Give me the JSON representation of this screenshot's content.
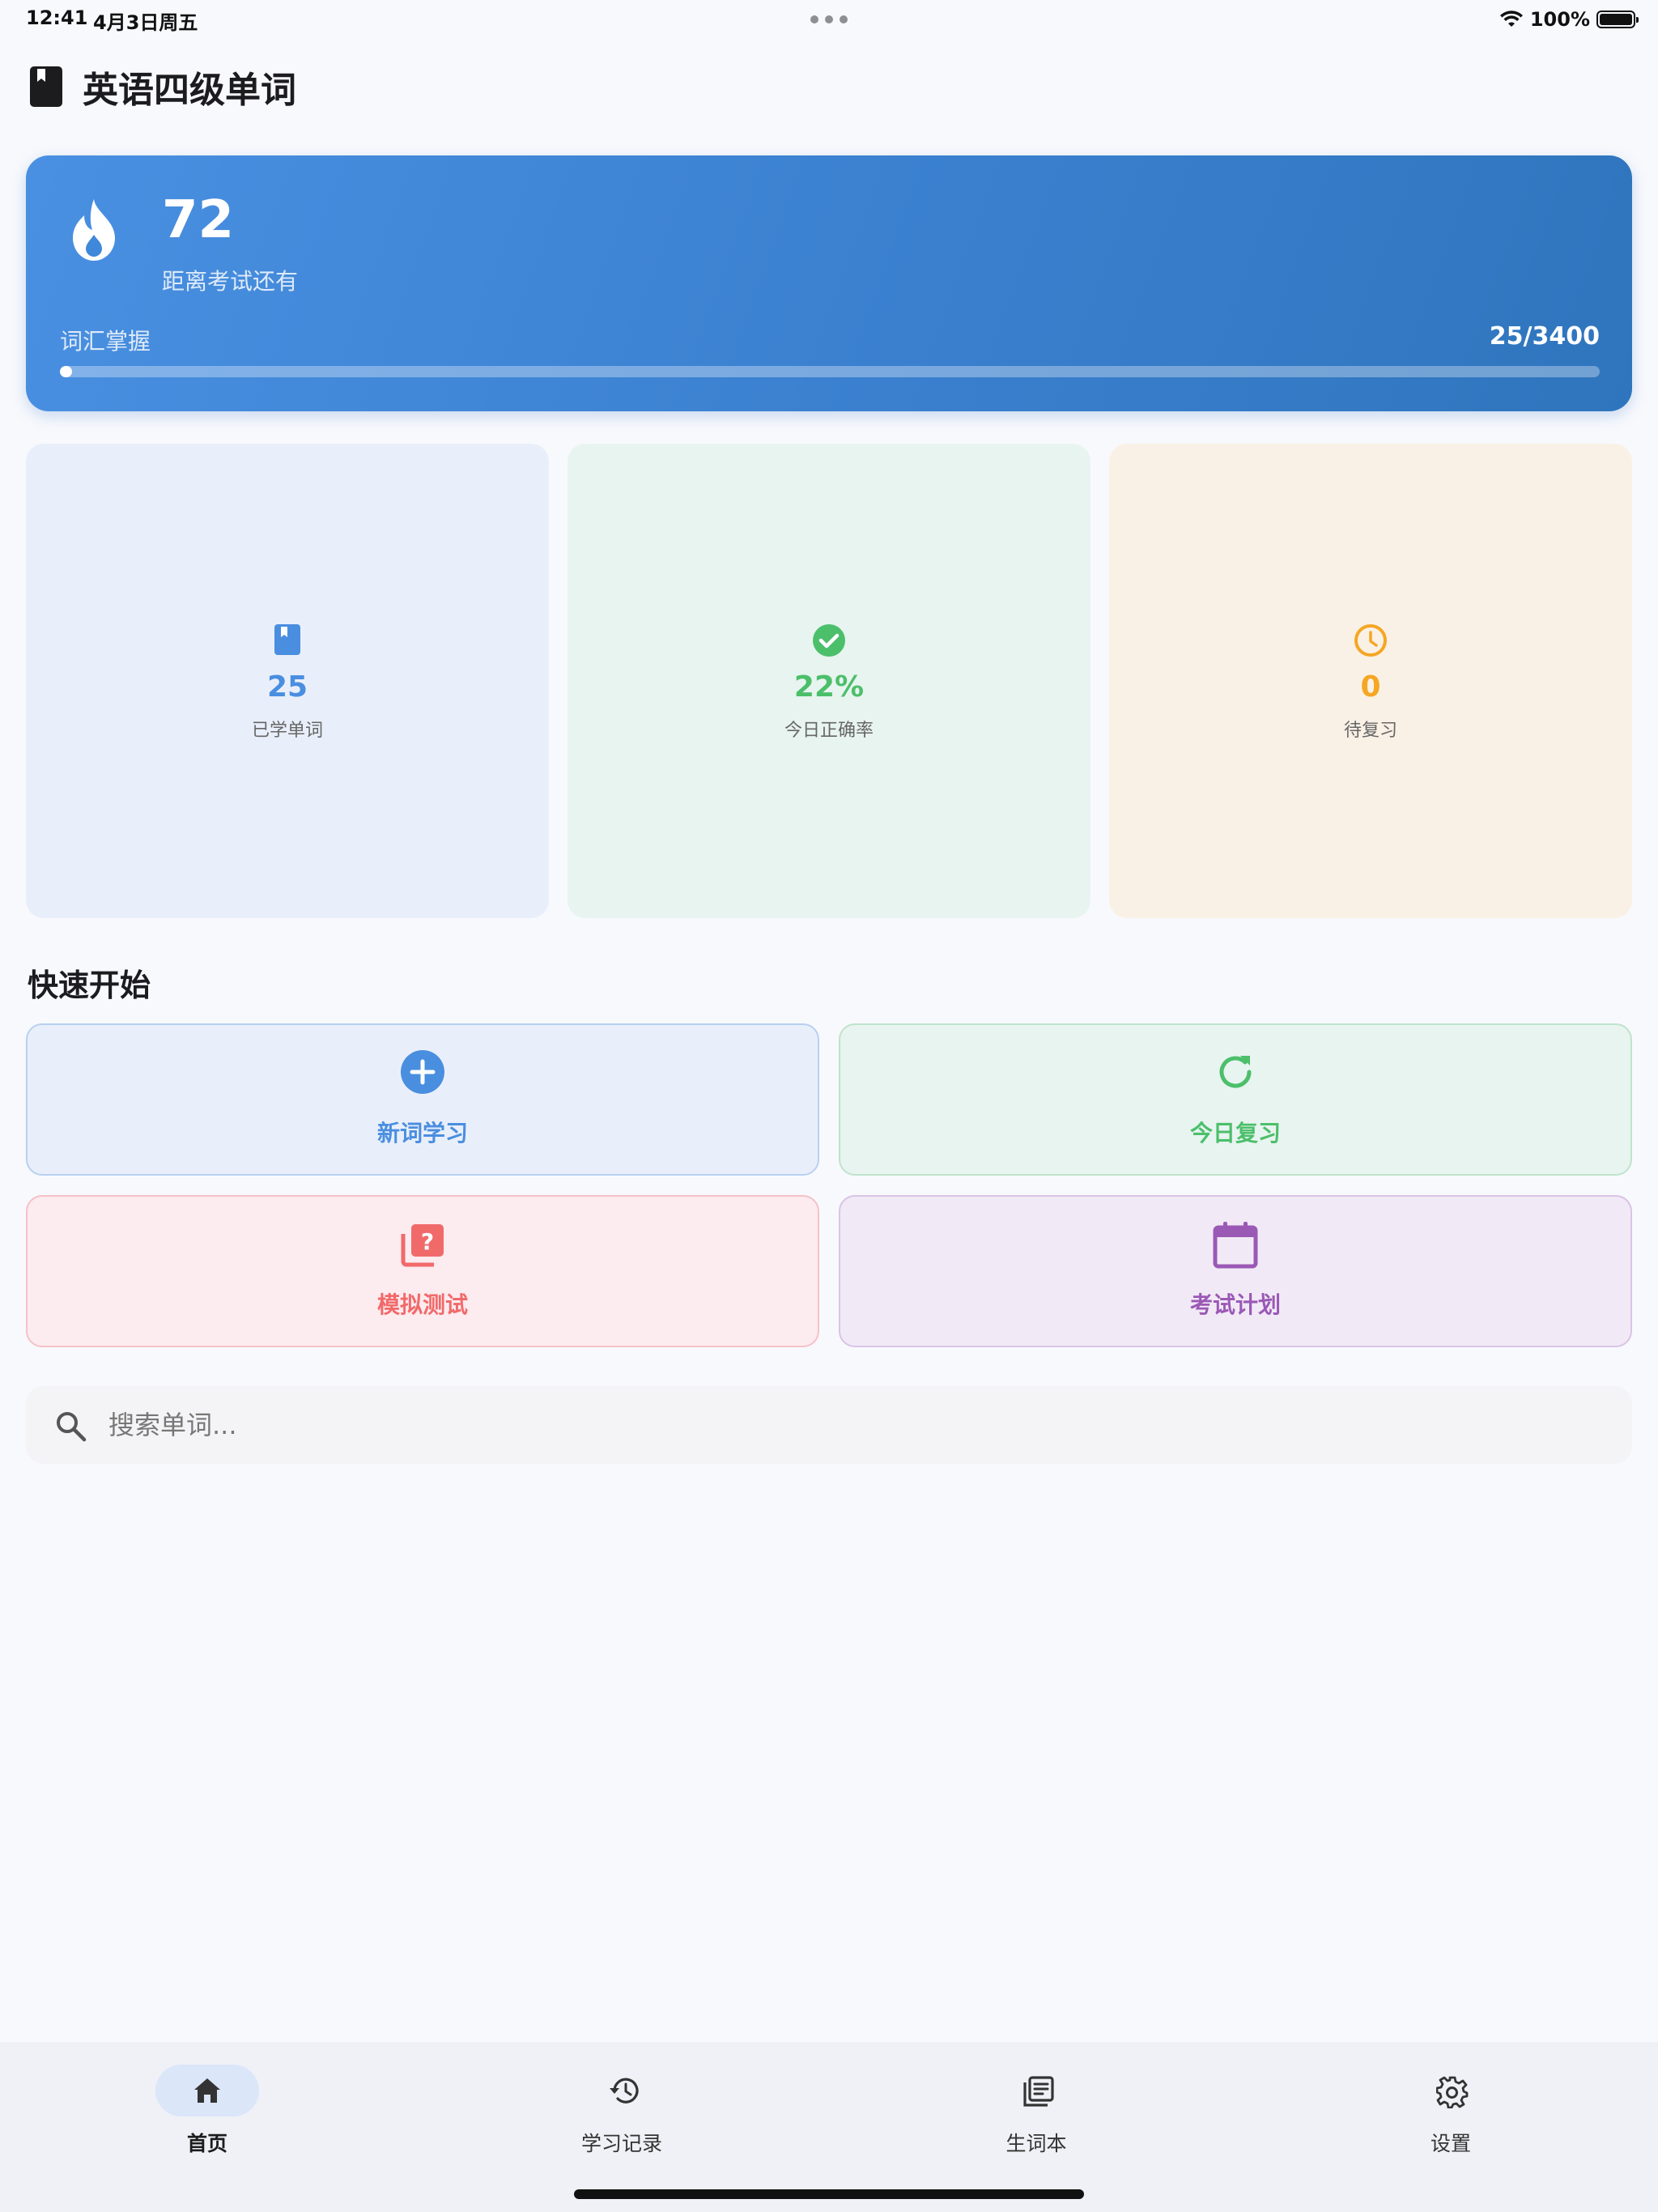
{
  "status_bar": {
    "time": "12:41",
    "date": "4月3日周五",
    "battery": "100%"
  },
  "header": {
    "title": "英语四级单词",
    "icon": "book-icon"
  },
  "hero": {
    "days": "72",
    "days_label": "距离考试还有",
    "vocab_label": "词汇掌握",
    "vocab_count": "25/3400",
    "progress_learned": 25,
    "progress_total": 3400,
    "icon": "flame-icon"
  },
  "stats": [
    {
      "value": "25",
      "label": "已学单词",
      "icon": "bookmark-icon",
      "color": "#4a8ee0",
      "bg": "#e9effa"
    },
    {
      "value": "22%",
      "label": "今日正确率",
      "icon": "check-circle-icon",
      "color": "#4cbf6b",
      "bg": "#e8f4f0"
    },
    {
      "value": "0",
      "label": "待复习",
      "icon": "clock-icon",
      "color": "#f5a623",
      "bg": "#faf1e6"
    }
  ],
  "quick_start": {
    "title": "快速开始",
    "actions": [
      {
        "label": "新词学习",
        "icon": "plus-circle-icon",
        "color": "#4a8ee0",
        "bg": "#e9effa",
        "border": "#b8d0f0"
      },
      {
        "label": "今日复习",
        "icon": "refresh-icon",
        "color": "#4cbf6b",
        "bg": "#e8f4f0",
        "border": "#bfe3cc"
      },
      {
        "label": "模拟测试",
        "icon": "quiz-icon",
        "color": "#f16a6a",
        "bg": "#fcebef",
        "border": "#f5c2c8"
      },
      {
        "label": "考试计划",
        "icon": "calendar-icon",
        "color": "#9b59b6",
        "bg": "#f1eaf6",
        "border": "#d9c4e6"
      }
    ]
  },
  "search": {
    "placeholder": "搜索单词...",
    "value": ""
  },
  "nav": {
    "items": [
      {
        "label": "首页",
        "icon": "home-icon",
        "active": true
      },
      {
        "label": "学习记录",
        "icon": "history-icon",
        "active": false
      },
      {
        "label": "生词本",
        "icon": "notebook-icon",
        "active": false
      },
      {
        "label": "设置",
        "icon": "gear-icon",
        "active": false
      }
    ]
  }
}
